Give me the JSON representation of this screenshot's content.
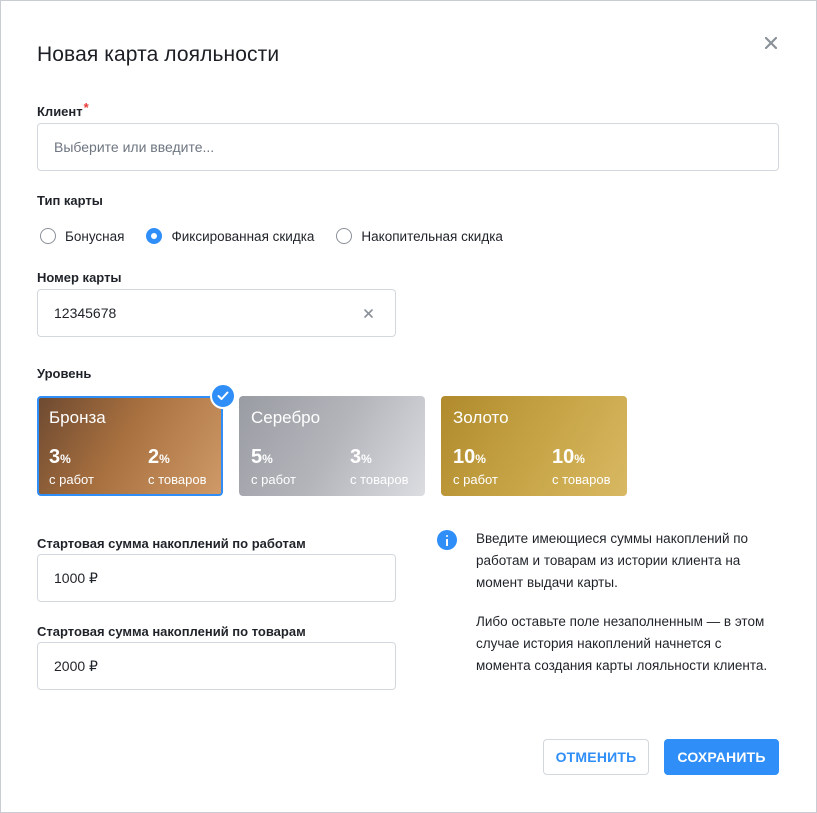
{
  "dialog": {
    "title": "Новая карта лояльности"
  },
  "client": {
    "label": "Клиент",
    "required_mark": "*",
    "placeholder": "Выберите или введите...",
    "value": ""
  },
  "card_type": {
    "label": "Тип карты",
    "options": [
      {
        "label": "Бонусная",
        "checked": false
      },
      {
        "label": "Фиксированная скидка",
        "checked": true
      },
      {
        "label": "Накопительная скидка",
        "checked": false
      }
    ]
  },
  "card_number": {
    "label": "Номер карты",
    "value": "12345678"
  },
  "level": {
    "label": "Уровень",
    "cards": [
      {
        "name": "Бронза",
        "works_pct": "3",
        "goods_pct": "2",
        "selected": true
      },
      {
        "name": "Серебро",
        "works_pct": "5",
        "goods_pct": "3",
        "selected": false
      },
      {
        "name": "Золото",
        "works_pct": "10",
        "goods_pct": "10",
        "selected": false
      }
    ],
    "pct_sign": "%",
    "works_caption": "с работ",
    "goods_caption": "с товаров"
  },
  "start_works": {
    "label": "Стартовая сумма накоплений по работам",
    "value": "1000 ₽"
  },
  "start_goods": {
    "label": "Стартовая сумма накоплений по товарам",
    "value": "2000 ₽"
  },
  "info": {
    "paragraph1": [
      "Введите имеющиеся суммы накоплений по",
      "работам и товарам из истории клиента на",
      "момент выдачи карты."
    ],
    "paragraph2": [
      "Либо оставьте поле незаполненным — в этом",
      "случае история накоплений начнется с",
      "момента создания карты лояльности клиента."
    ]
  },
  "buttons": {
    "cancel": "ОТМЕНИТЬ",
    "save": "СОХРАНИТЬ"
  },
  "colors": {
    "accent": "#2f8ef7",
    "required": "#e53935"
  },
  "icons": {
    "close": "close-icon",
    "clear": "clear-icon",
    "check": "check-icon",
    "info": "info-icon"
  }
}
